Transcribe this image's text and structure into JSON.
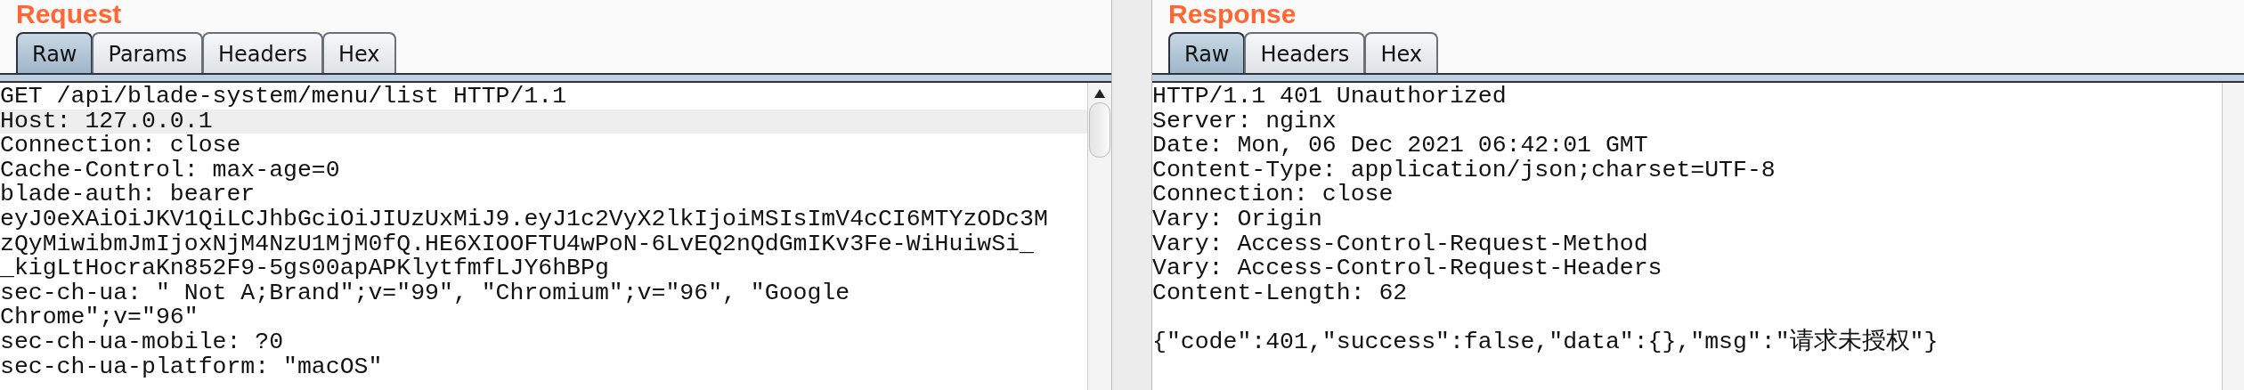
{
  "request": {
    "title": "Request",
    "tabs": [
      {
        "label": "Raw",
        "selected": true
      },
      {
        "label": "Params",
        "selected": false
      },
      {
        "label": "Headers",
        "selected": false
      },
      {
        "label": "Hex",
        "selected": false
      }
    ],
    "lines": [
      {
        "text": "GET /api/blade-system/menu/list HTTP/1.1",
        "highlighted": false
      },
      {
        "text": "Host: 127.0.0.1",
        "highlighted": true
      },
      {
        "text": "Connection: close",
        "highlighted": false
      },
      {
        "text": "Cache-Control: max-age=0",
        "highlighted": false
      },
      {
        "text": "blade-auth: bearer",
        "highlighted": false
      },
      {
        "text": "eyJ0eXAiOiJKV1QiLCJhbGciOiJIUzUxMiJ9.eyJ1c2VyX2lkIjoiMSIsImV4cCI6MTYzODc3M",
        "highlighted": false
      },
      {
        "text": "zQyMiwibmJmIjoxNjM4NzU1MjM0fQ.HE6XIOOFTU4wPoN-6LvEQ2nQdGmIKv3Fe-WiHuiwSi_",
        "highlighted": false
      },
      {
        "text": "_kigLtHocraKn852F9-5gs00apAPKlytfmfLJY6hBPg",
        "highlighted": false
      },
      {
        "text": "sec-ch-ua: \" Not A;Brand\";v=\"99\", \"Chromium\";v=\"96\", \"Google",
        "highlighted": false
      },
      {
        "text": "Chrome\";v=\"96\"",
        "highlighted": false
      },
      {
        "text": "sec-ch-ua-mobile: ?0",
        "highlighted": false
      },
      {
        "text": "sec-ch-ua-platform: \"macOS\"",
        "highlighted": false
      }
    ]
  },
  "response": {
    "title": "Response",
    "tabs": [
      {
        "label": "Raw",
        "selected": true
      },
      {
        "label": "Headers",
        "selected": false
      },
      {
        "label": "Hex",
        "selected": false
      }
    ],
    "lines": [
      {
        "text": "HTTP/1.1 401 Unauthorized",
        "highlighted": false
      },
      {
        "text": "Server: nginx",
        "highlighted": false
      },
      {
        "text": "Date: Mon, 06 Dec 2021 06:42:01 GMT",
        "highlighted": false
      },
      {
        "text": "Content-Type: application/json;charset=UTF-8",
        "highlighted": false
      },
      {
        "text": "Connection: close",
        "highlighted": false
      },
      {
        "text": "Vary: Origin",
        "highlighted": false
      },
      {
        "text": "Vary: Access-Control-Request-Method",
        "highlighted": false
      },
      {
        "text": "Vary: Access-Control-Request-Headers",
        "highlighted": false
      },
      {
        "text": "Content-Length: 62",
        "highlighted": false
      },
      {
        "highlighted": false
      },
      {
        "text": "{\"code\":401,\"success\":false,\"data\":{},\"msg\":\"请求未授权\"}",
        "highlighted": false
      }
    ]
  }
}
